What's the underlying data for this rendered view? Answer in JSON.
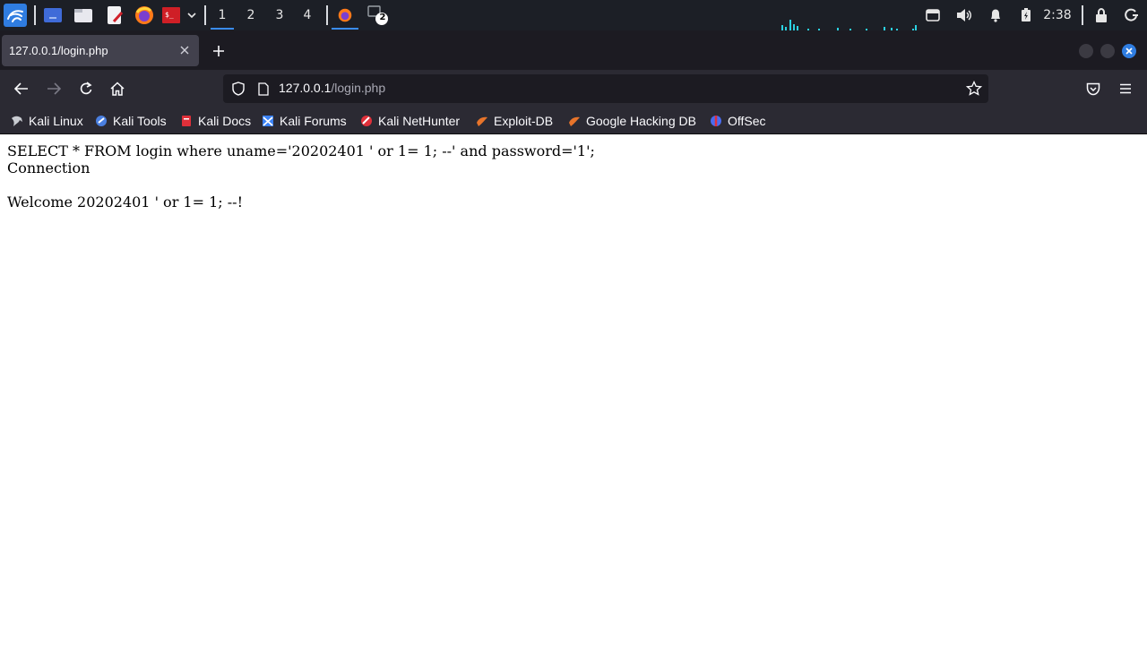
{
  "taskbar": {
    "workspaces": [
      "1",
      "2",
      "3",
      "4"
    ],
    "active_workspace": "1",
    "terminal_badge": "2",
    "clock": "2:38",
    "icons": [
      "kali-menu-icon",
      "desktop-icon",
      "file-manager-icon",
      "text-editor-icon",
      "firefox-icon",
      "terminal-icon",
      "dropdown-icon",
      "display-icon",
      "volume-icon",
      "notification-icon",
      "battery-icon",
      "lock-icon",
      "logout-icon"
    ]
  },
  "browser": {
    "tab_title": "127.0.0.1/login.php",
    "url_host": "127.0.0.1",
    "url_path": "/login.php",
    "bookmarks": [
      {
        "label": "Kali Linux",
        "icon": "kali-dragon-icon",
        "color": "#9aa0a6"
      },
      {
        "label": "Kali Tools",
        "icon": "kali-tools-icon",
        "color": "#4a7fe0"
      },
      {
        "label": "Kali Docs",
        "icon": "kali-docs-icon",
        "color": "#e0303a"
      },
      {
        "label": "Kali Forums",
        "icon": "kali-forums-icon",
        "color": "#3b82f6"
      },
      {
        "label": "Kali NetHunter",
        "icon": "nethunter-icon",
        "color": "#e0303a"
      },
      {
        "label": "Exploit-DB",
        "icon": "exploit-db-icon",
        "color": "#e8742a"
      },
      {
        "label": "Google Hacking DB",
        "icon": "ghdb-icon",
        "color": "#e8742a"
      },
      {
        "label": "OffSec",
        "icon": "offsec-icon",
        "color": "#4a6cf0"
      }
    ]
  },
  "page": {
    "line1": "SELECT * FROM login where uname='20202401 ' or 1= 1; --' and password='1';",
    "line2": "Connection",
    "line3": "Welcome 20202401 ' or 1= 1; --!"
  },
  "colors": {
    "panel_bg": "#1c1f26",
    "tab_bg": "#42414d",
    "toolbar_bg": "#2b2a33",
    "accent": "#3a8cf0"
  }
}
